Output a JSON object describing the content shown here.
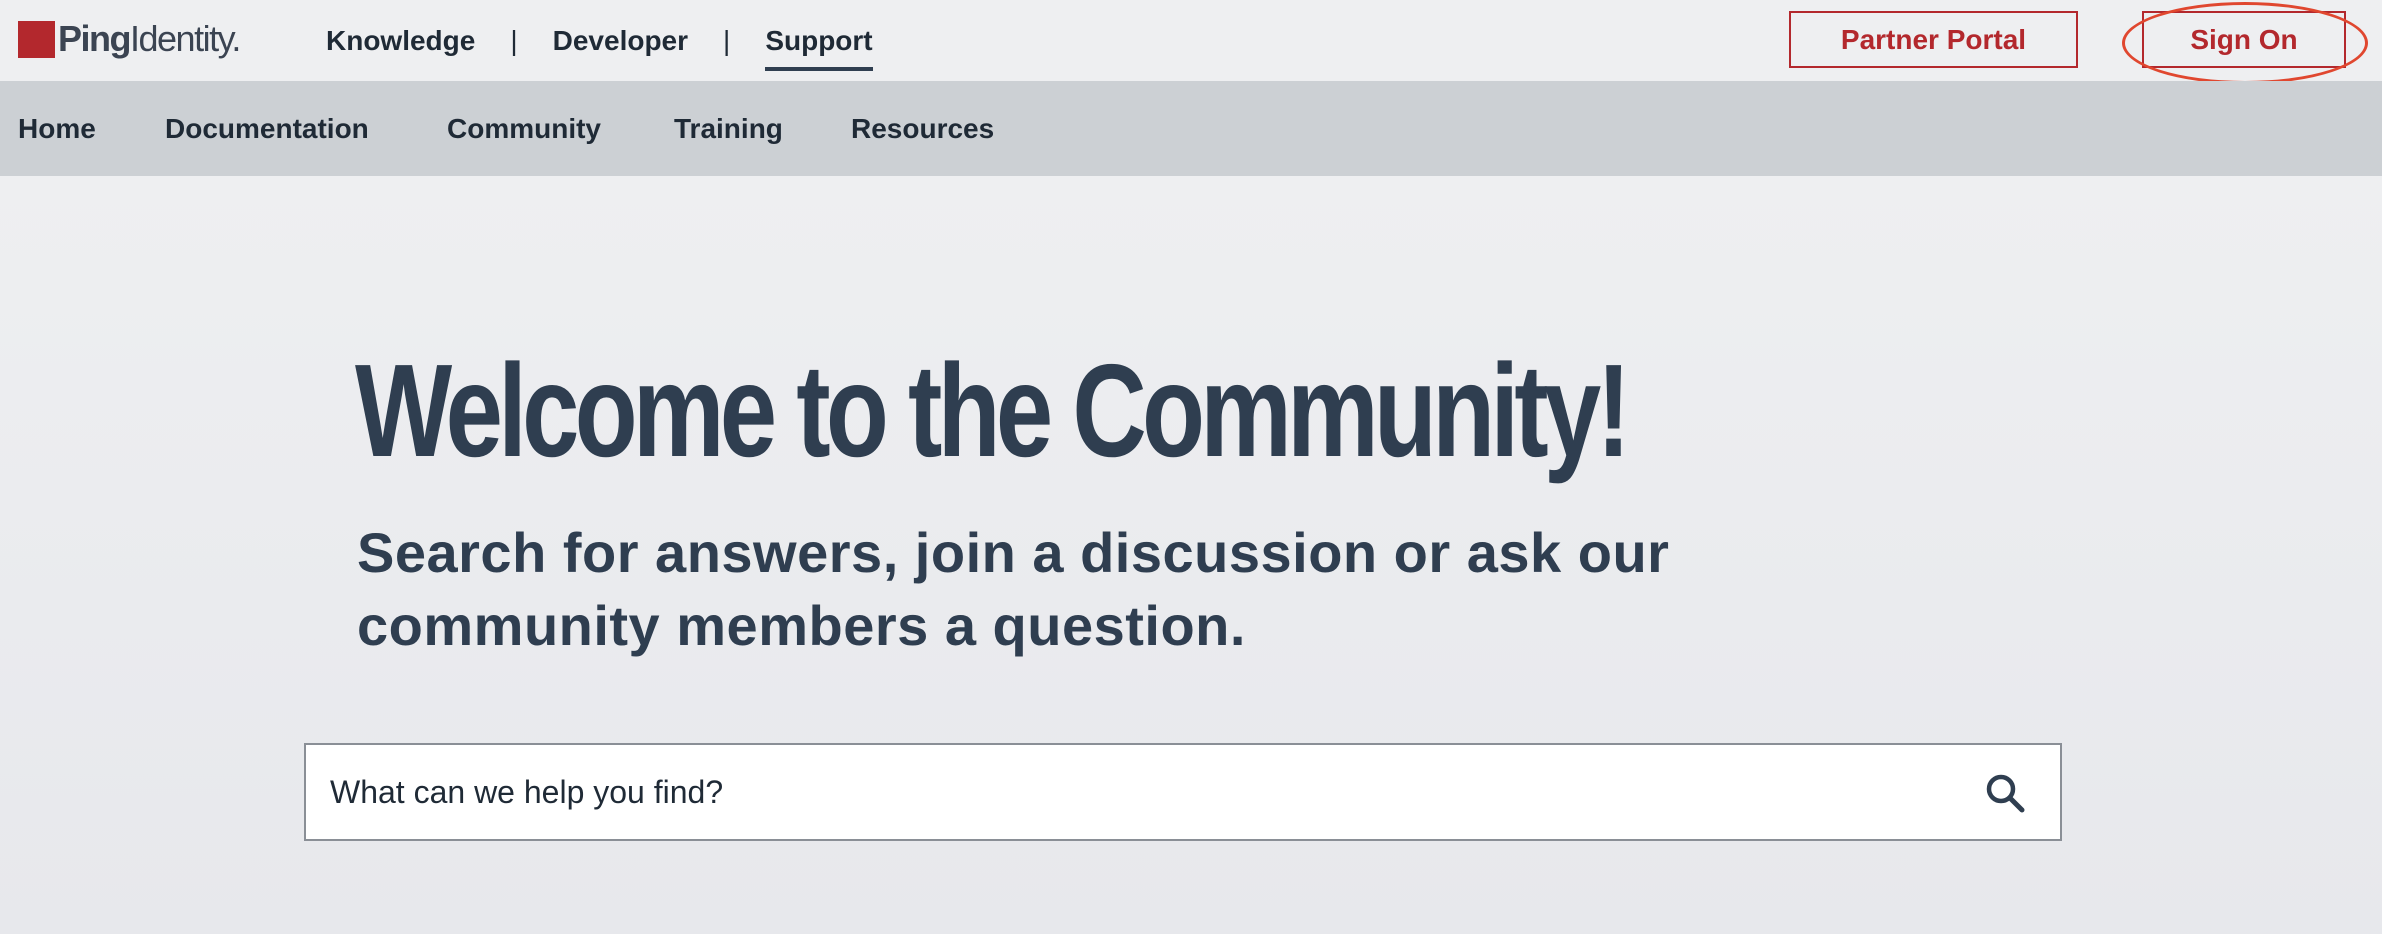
{
  "brand": {
    "name_bold": "Ping",
    "name_light": "Identity.",
    "color": "#b3282d"
  },
  "topnav": {
    "items": [
      "Knowledge",
      "Developer",
      "Support"
    ],
    "separator": "|",
    "active": "Support"
  },
  "actions": {
    "partner_portal": "Partner Portal",
    "sign_on": "Sign On",
    "accent_color": "#b3282d",
    "highlight_color": "#e0472f"
  },
  "subnav": {
    "items": [
      "Home",
      "Documentation",
      "Community",
      "Training",
      "Resources"
    ]
  },
  "hero": {
    "title": "Welcome to the Community!",
    "subtitle": "Search for answers, join a discussion or ask our community members a question."
  },
  "search": {
    "placeholder": "What can we help you find?",
    "icon": "search-icon"
  }
}
